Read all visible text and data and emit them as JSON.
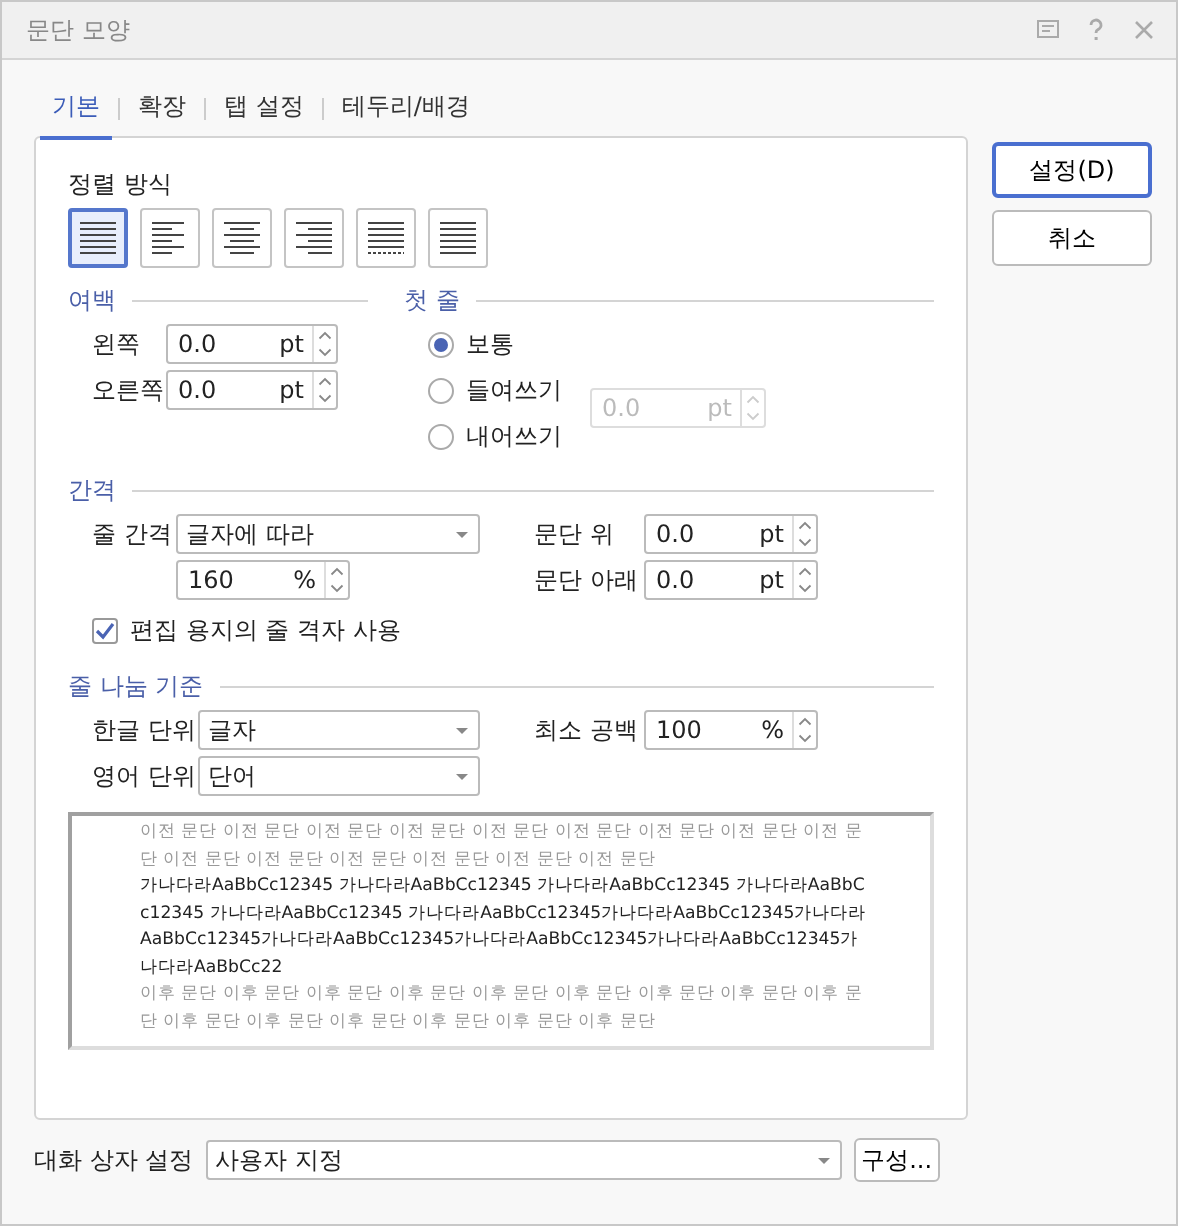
{
  "window": {
    "title": "문단 모양"
  },
  "tabs": [
    {
      "label": "기본",
      "selected": true
    },
    {
      "label": "확장",
      "selected": false
    },
    {
      "label": "탭 설정",
      "selected": false
    },
    {
      "label": "테두리/배경",
      "selected": false
    }
  ],
  "alignment": {
    "label": "정렬 방식",
    "buttons": [
      {
        "kind": "justify",
        "selected": true
      },
      {
        "kind": "left",
        "selected": false
      },
      {
        "kind": "center",
        "selected": false
      },
      {
        "kind": "right",
        "selected": false
      },
      {
        "kind": "distribute",
        "selected": false
      },
      {
        "kind": "split",
        "selected": false
      }
    ]
  },
  "margin": {
    "label": "여백",
    "fields": [
      {
        "label": "왼쪽",
        "value": "0.0",
        "unit": "pt"
      },
      {
        "label": "오른쪽",
        "value": "0.0",
        "unit": "pt"
      }
    ]
  },
  "first_line": {
    "label": "첫 줄",
    "options": [
      {
        "label": "보통",
        "selected": true
      },
      {
        "label": "들여쓰기",
        "selected": false
      },
      {
        "label": "내어쓰기",
        "selected": false
      }
    ],
    "field": {
      "value": "0.0",
      "unit": "pt",
      "disabled": true
    }
  },
  "spacing": {
    "label": "간격",
    "line_spacing": {
      "label": "줄 간격",
      "value": "글자에 따라",
      "amount": {
        "value": "160",
        "unit": "%"
      }
    },
    "para_fields": [
      {
        "label": "문단 위",
        "value": "0.0",
        "unit": "pt"
      },
      {
        "label": "문단 아래",
        "value": "0.0",
        "unit": "pt"
      }
    ],
    "grid_checkbox": {
      "label": "편집 용지의 줄 격자 사용",
      "checked": true
    }
  },
  "line_break": {
    "label": "줄 나눔 기준",
    "hangul": {
      "label": "한글 단위",
      "value": "글자"
    },
    "english": {
      "label": "영어 단위",
      "value": "단어"
    },
    "min_space": {
      "label": "최소 공백",
      "value": "100",
      "unit": "%"
    }
  },
  "preview": {
    "before": "이전 문단 이전 문단 이전 문단 이전 문단 이전 문단 이전 문단 이전 문단 이전 문단 이전 문단 이전 문단 이전 문단 이전 문단 이전 문단 이전 문단 이전 문단",
    "sample": "가나다라AaBbCc12345 가나다라AaBbCc12345 가나다라AaBbCc12345 가나다라AaBbCc12345 가나다라AaBbCc12345 가나다라AaBbCc12345가나다라AaBbCc12345가나다라AaBbCc12345가나다라AaBbCc12345가나다라AaBbCc12345가나다라AaBbCc12345가나다라AaBbCc22",
    "after": "이후 문단 이후 문단 이후 문단 이후 문단 이후 문단 이후 문단 이후 문단 이후 문단 이후 문단 이후 문단 이후 문단 이후 문단 이후 문단 이후 문단 이후 문단"
  },
  "buttons": [
    {
      "label": "설정(D)",
      "default": true
    },
    {
      "label": "취소",
      "default": false
    }
  ],
  "dialog_settings": {
    "label": "대화 상자 설정",
    "value": "사용자 지정",
    "button": "구성..."
  }
}
